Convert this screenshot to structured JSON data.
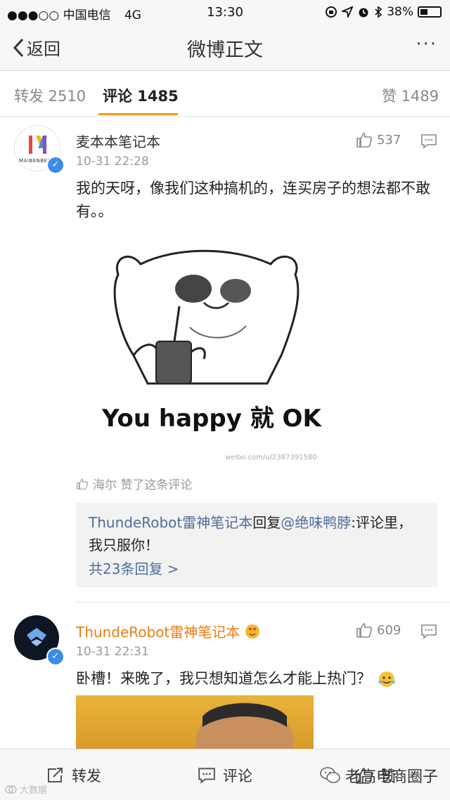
{
  "status_bar": {
    "carrier": "●●●○○ 中国电信",
    "network": "4G",
    "time": "13:30",
    "battery": "38%",
    "battery_level": 0.38
  },
  "nav": {
    "back_label": "返回",
    "title": "微博正文",
    "more": "···"
  },
  "tabs": [
    {
      "label": "转发 2510",
      "active": false
    },
    {
      "label": "评论 1485",
      "active": true
    },
    {
      "label": "赞 1489",
      "active": false
    }
  ],
  "comments": [
    {
      "user": "麦本本笔记本",
      "avatar_text": "MAIBENBEN",
      "time": "10-31 22:28",
      "likes": "537",
      "text": "我的天呀，像我们这种搞机的，连买房子的想法都不敢有。。",
      "image_caption": "You happy 就 OK",
      "image_watermark": "weibo.com/u/2387391580",
      "liked_by": "海尔 赞了这条评论",
      "reply": {
        "author": "ThundeRobot雷神笔记本",
        "verb": "回复",
        "target": "@绝味鸭脖",
        "text": ":评论里，我只服你！",
        "more": "共23条回复 >"
      }
    },
    {
      "user": "ThundeRobot雷神笔记本",
      "time": "10-31 22:31",
      "likes": "609",
      "text": "卧槽！来晚了，我只想知道怎么才能上热门？"
    }
  ],
  "bottom_bar": {
    "repost": "转发",
    "comment": "评论",
    "like": "赞"
  },
  "watermarks": {
    "wechat": "老高电商圈子",
    "corner": "大数据"
  },
  "colors": {
    "accent": "#f39a19",
    "link": "#4e6e9e",
    "vip_name": "#e97d13",
    "verified": "#3d8be8"
  }
}
